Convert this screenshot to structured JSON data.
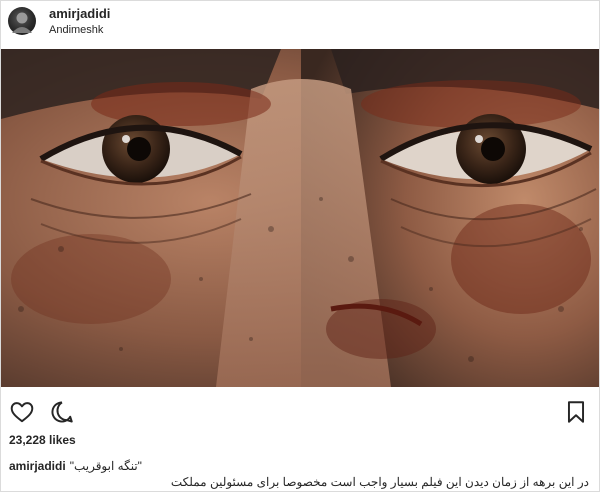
{
  "post": {
    "username": "amirjadidi",
    "location": "Andimeshk",
    "likes": "23,228 likes",
    "caption_user": "amirjadidi",
    "caption_title": "\"تنگه ابوقریب\"",
    "caption_text": "در این برهه از زمان دیدن این فیلم بسیار واجب است مخصوصا برای مسئولین مملکت"
  },
  "icons": {
    "like": "heart-icon",
    "comment": "speech-bubble-icon",
    "save": "bookmark-icon"
  },
  "colors": {
    "text": "#262626",
    "border": "#dbdbdb",
    "skin": "#a06a4e",
    "blood": "#7a2a18"
  }
}
